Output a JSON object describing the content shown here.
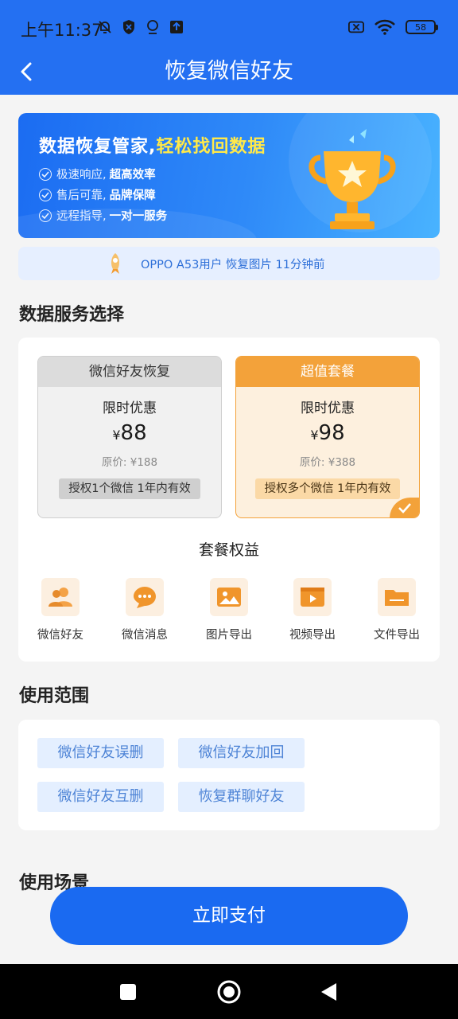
{
  "status_bar": {
    "time": "上午11:37",
    "battery": "58",
    "icons": [
      "mute-bell-icon",
      "shield-icon",
      "location-pin-icon",
      "upload-icon",
      "sim-off-icon",
      "wifi-icon",
      "battery-icon"
    ]
  },
  "header": {
    "title": "恢复微信好友",
    "back_icon": "chevron-left-icon"
  },
  "banner": {
    "title_plain": "数据恢复管家,",
    "title_highlight": "轻松找回数据",
    "features": [
      {
        "plain": "极速响应,",
        "bold": "超高效率"
      },
      {
        "plain": "售后可靠,",
        "bold": "品牌保障"
      },
      {
        "plain": "远程指导,",
        "bold": "一对一服务"
      }
    ],
    "image": "trophy-icon"
  },
  "notice": {
    "text": "OPPO A53用户 恢复图片 11分钟前",
    "icon": "rocket-icon"
  },
  "service": {
    "section_title": "数据服务选择",
    "plans": [
      {
        "name": "微信好友恢复",
        "promo": "限时优惠",
        "currency": "¥",
        "price": "88",
        "original": "原价: ¥188",
        "tag": "授权1个微信 1年内有效",
        "selected": false
      },
      {
        "name": "超值套餐",
        "promo": "限时优惠",
        "currency": "¥",
        "price": "98",
        "original": "原价: ¥388",
        "tag": "授权多个微信 1年内有效",
        "selected": true
      }
    ],
    "benefits_title": "套餐权益",
    "benefits": [
      {
        "label": "微信好友",
        "icon": "contacts-icon"
      },
      {
        "label": "微信消息",
        "icon": "chat-bubble-icon"
      },
      {
        "label": "图片导出",
        "icon": "image-icon"
      },
      {
        "label": "视频导出",
        "icon": "video-icon"
      },
      {
        "label": "文件导出",
        "icon": "folder-icon"
      }
    ]
  },
  "scope": {
    "section_title": "使用范围",
    "chips": [
      "微信好友误删",
      "微信好友加回",
      "微信好友互删",
      "恢复群聊好友"
    ]
  },
  "scenario": {
    "section_title": "使用场景"
  },
  "pay_button": "立即支付",
  "colors": {
    "primary": "#2470f2",
    "accent_orange": "#f3a23a",
    "chip_bg": "#e4efff",
    "chip_text": "#4e84d6"
  }
}
